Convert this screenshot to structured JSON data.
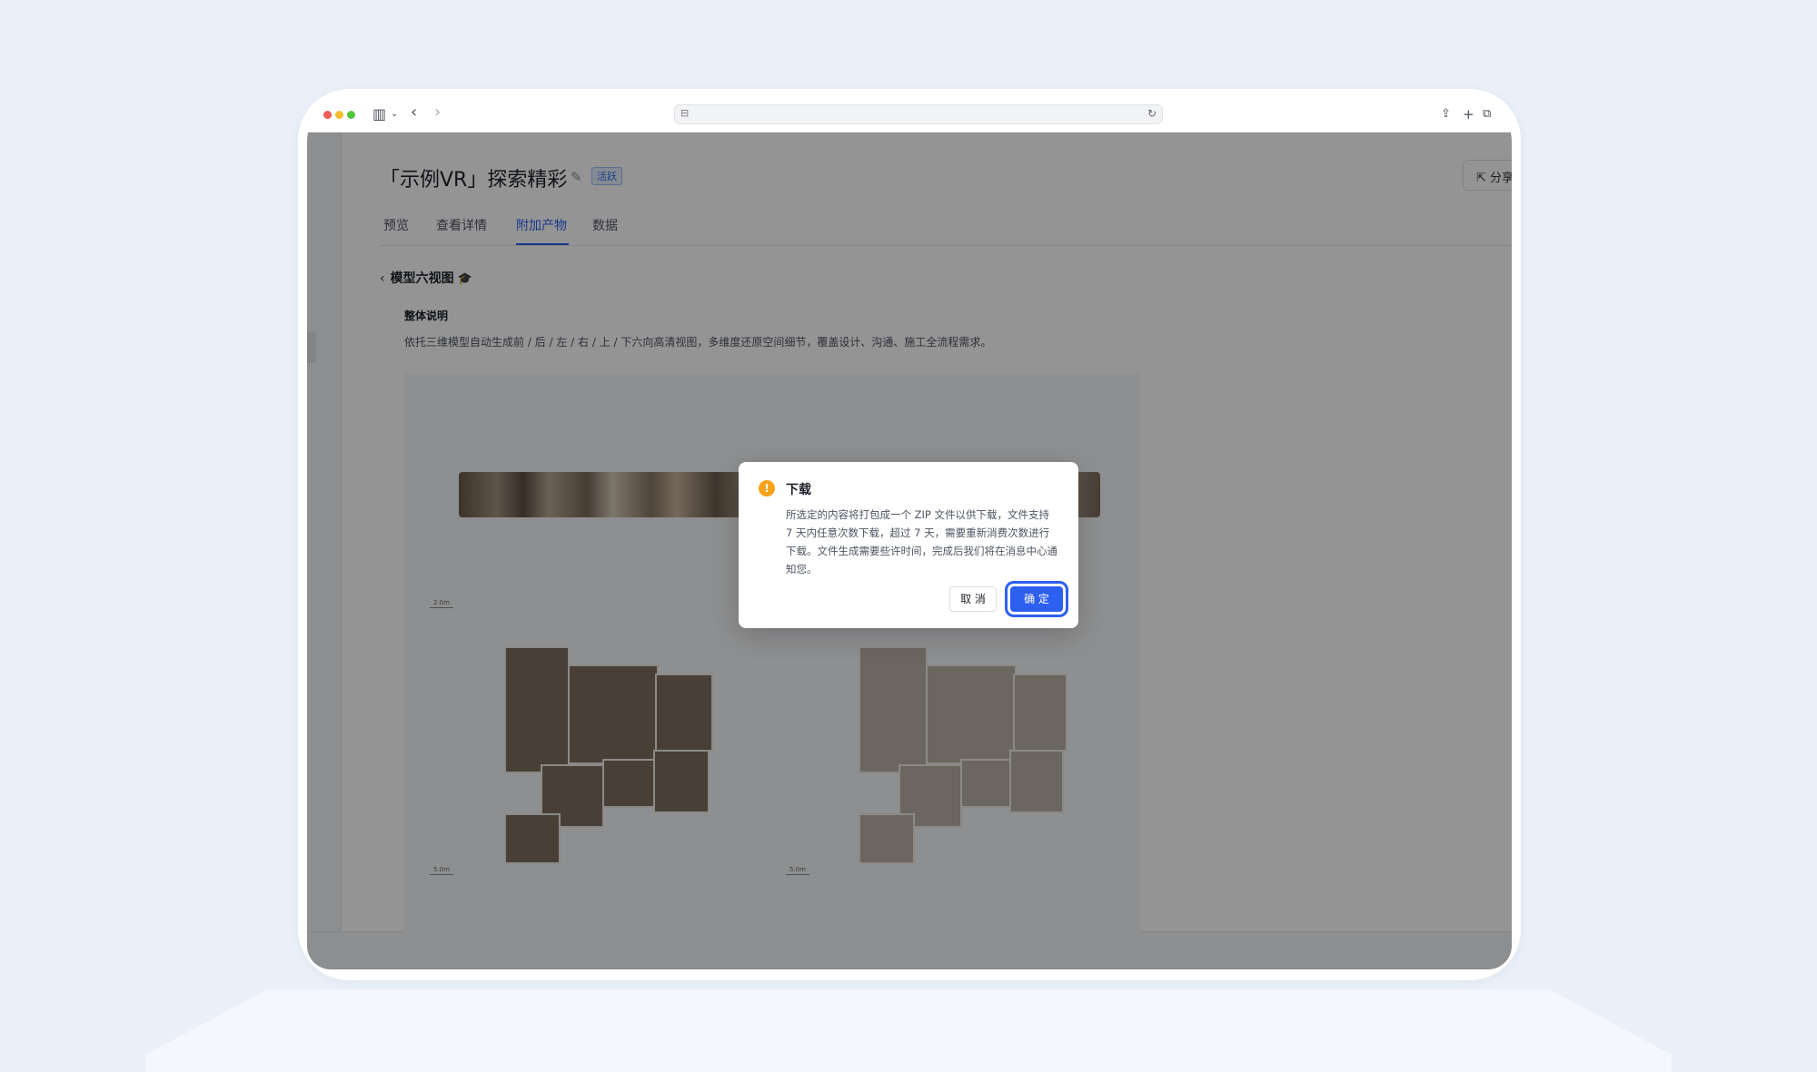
{
  "page": {
    "title": "「示例VR」探索精彩",
    "status_badge": "活跃",
    "share_label": "分享",
    "tabs": [
      {
        "label": "预览"
      },
      {
        "label": "查看详情"
      },
      {
        "label": "附加产物"
      },
      {
        "label": "数据"
      }
    ],
    "active_tab": "附加产物",
    "back_label": "模型六视图",
    "section_title": "整体说明",
    "section_desc": "依托三维模型自动生成前 / 后 / 左 / 右 / 上 / 下六向高清视图，多维度还原空间细节，覆盖设计、沟通、施工全流程需求。",
    "scale_labels": [
      "2.0m",
      "5.0m",
      "5.0m"
    ]
  },
  "dialog": {
    "title": "下载",
    "body": "所选定的内容将打包成一个 ZIP 文件以供下载，文件支持 7 天内任意次数下载，超过 7 天，需要重新消费次数进行下载。文件生成需要些许时间，完成后我们将在消息中心通知您。",
    "cancel_label": "取 消",
    "ok_label": "确 定"
  },
  "colors": {
    "primary": "#2d5ff0",
    "warning": "#f7a21b",
    "background": "#ebf0f8"
  }
}
